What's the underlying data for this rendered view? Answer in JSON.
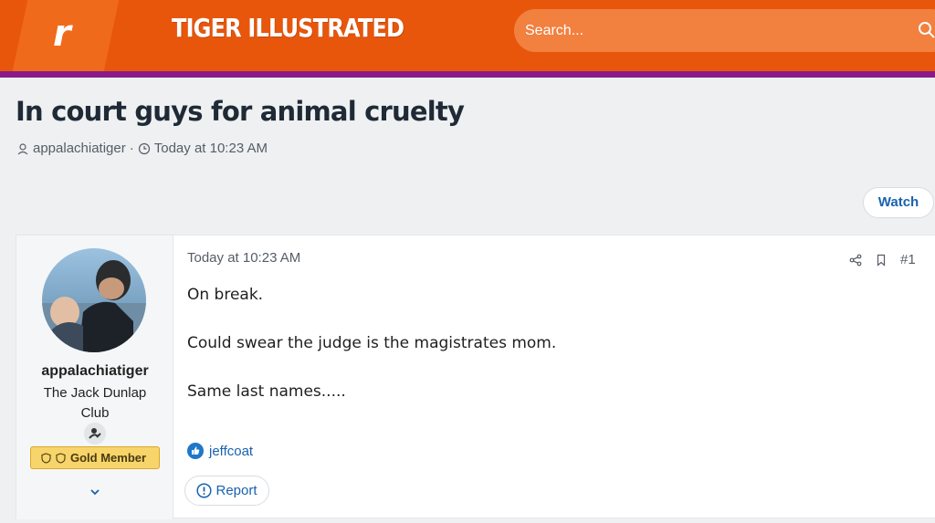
{
  "header": {
    "logo_letter": "r",
    "site_name": "TIGER ILLUSTRATED",
    "search_placeholder": "Search..."
  },
  "thread": {
    "title": "In court guys for animal cruelty",
    "author": "appalachiatiger",
    "separator": "·",
    "posted": "Today at 10:23 AM",
    "watch_label": "Watch"
  },
  "post": {
    "username": "appalachiatiger",
    "user_title": "The Jack Dunlap Club",
    "badge": "Gold Member",
    "date": "Today at 10:23 AM",
    "number": "#1",
    "body": [
      "On break.",
      "Could swear the judge is the magistrates mom.",
      "Same last names....."
    ],
    "reaction_user": "jeffcoat",
    "report_label": "Report"
  },
  "colors": {
    "header": "#e8560c",
    "header_stripe": "#8a1a8a",
    "link": "#1862b0",
    "gold_badge": "#f7d56b"
  },
  "icons": [
    "search-icon",
    "user-icon",
    "clock-icon",
    "share-icon",
    "bookmark-icon",
    "like-icon",
    "report-icon",
    "chevron-down-icon",
    "shield-icon",
    "user-badge-icon"
  ]
}
